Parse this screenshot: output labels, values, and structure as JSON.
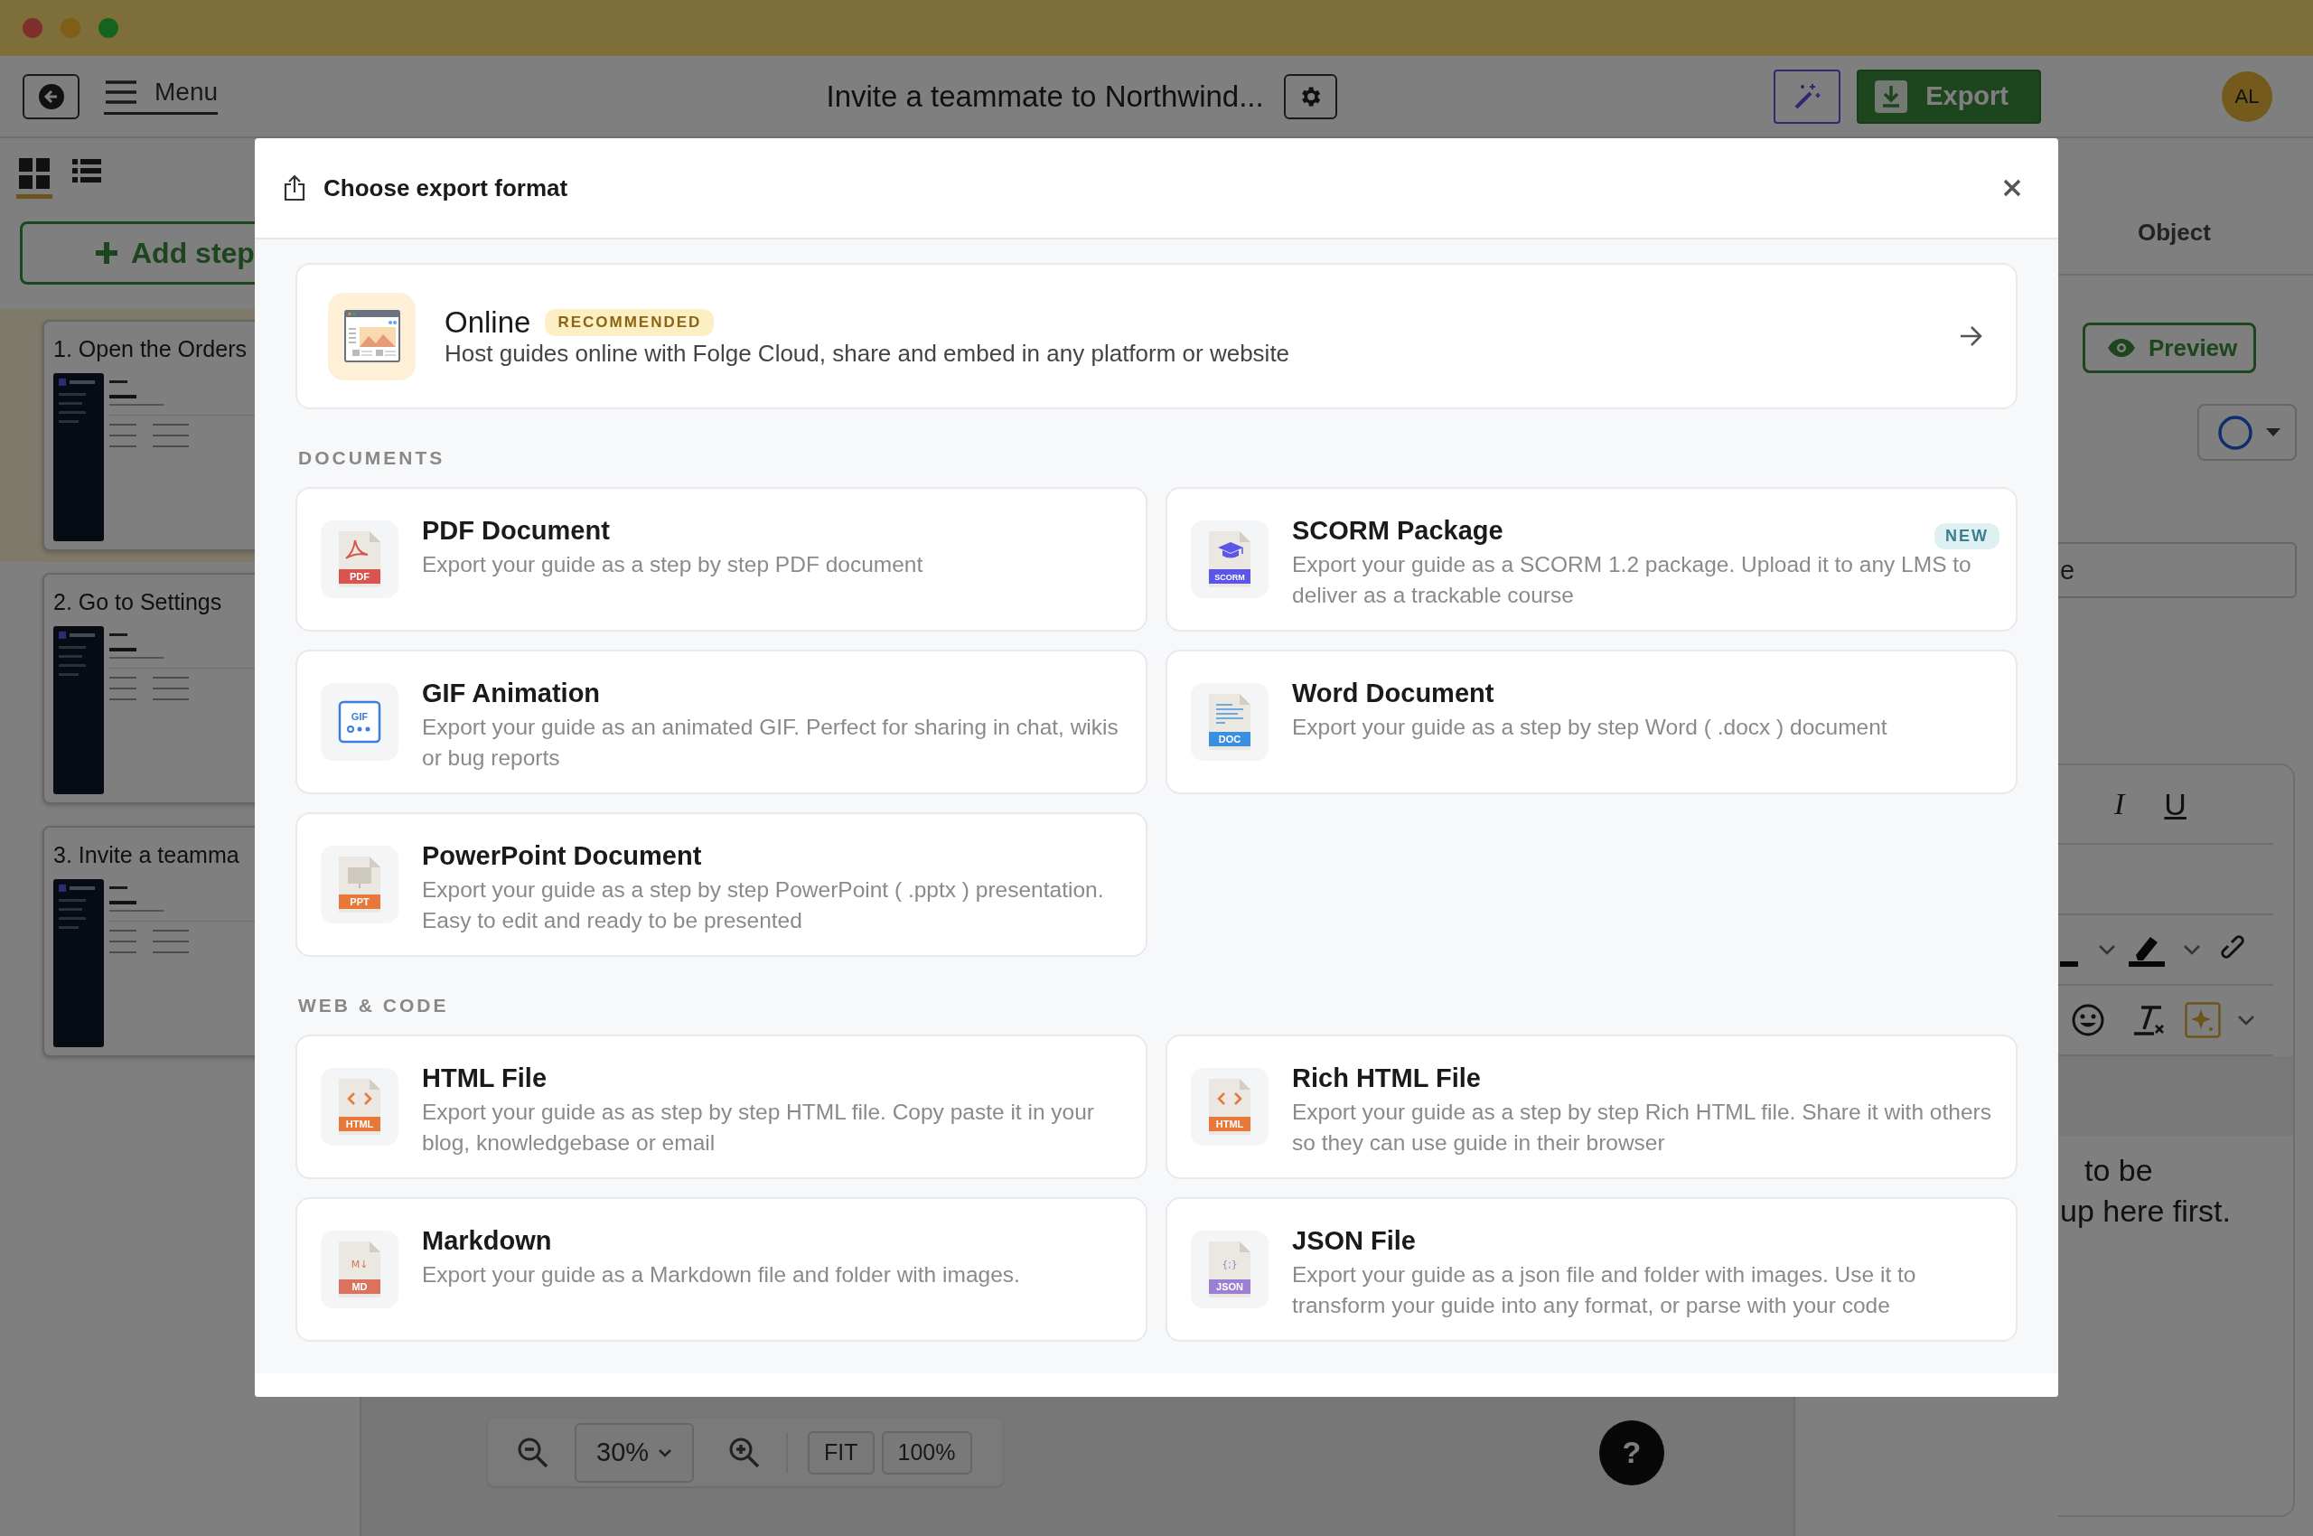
{
  "toolbar": {
    "menu_label": "Menu",
    "document_title": "Invite a teammate to Northwind...",
    "export_label": "Export",
    "avatar_initials": "AL"
  },
  "sidebar": {
    "views": [
      {
        "kind": "grid",
        "selected": true
      },
      {
        "kind": "list",
        "selected": false
      }
    ],
    "add_step_label": "Add step",
    "steps": [
      {
        "title": "1. Open the Orders",
        "selected": true
      },
      {
        "title": "2. Go to Settings",
        "selected": false
      },
      {
        "title": "3. Invite a teamma",
        "selected": false
      }
    ]
  },
  "inspector": {
    "tab_label": "Object",
    "preview_label": "Preview",
    "field_value": "e",
    "format_buttons": [
      "I",
      "U"
    ],
    "text_lines": [
      "to be",
      "up here first."
    ]
  },
  "zoom_bar": {
    "zoom_level": "30%",
    "fit_label": "FIT",
    "actual_size_label": "100%",
    "help_label": "?"
  },
  "export_dialog": {
    "title": "Choose export format",
    "featured": {
      "title": "Online",
      "badge": "RECOMMENDED",
      "description": "Host guides online with Folge Cloud, share and embed in any platform or website"
    },
    "sections": [
      {
        "heading": "DOCUMENTS",
        "formats": [
          {
            "kind": "pdf",
            "title": "PDF Document",
            "description": "Export your guide as a step by step PDF document",
            "icon_label": "PDF",
            "color": "#d9534f"
          },
          {
            "kind": "scorm",
            "title": "SCORM Package",
            "description": "Export your guide as a SCORM 1.2 package. Upload it to any LMS to deliver as a trackable course",
            "icon_label": "SCORM",
            "color": "#5b55e8",
            "badge": "NEW"
          },
          {
            "kind": "gif",
            "title": "GIF Animation",
            "description": "Export your guide as an animated GIF. Perfect for sharing in chat, wikis or bug reports",
            "icon_label": "GIF",
            "color": "#3b7de0"
          },
          {
            "kind": "doc",
            "title": "Word Document",
            "description": "Export your guide as a step by step Word ( .docx ) document",
            "icon_label": "DOC",
            "color": "#3b8fe0"
          },
          {
            "kind": "ppt",
            "title": "PowerPoint Document",
            "description": "Export your guide as a step by step PowerPoint ( .pptx ) presentation. Easy to edit and ready to be presented",
            "icon_label": "PPT",
            "color": "#e8773a"
          }
        ]
      },
      {
        "heading": "WEB & CODE",
        "formats": [
          {
            "kind": "html",
            "title": "HTML File",
            "description": "Export your guide as as step by step HTML file. Copy paste it in your blog, knowledgebase or email",
            "icon_label": "HTML",
            "color": "#e8773a"
          },
          {
            "kind": "html",
            "title": "Rich HTML File",
            "description": "Export your guide as a step by step Rich HTML file. Share it with others so they can use guide in their browser",
            "icon_label": "HTML",
            "color": "#e8773a"
          },
          {
            "kind": "markdown",
            "title": "Markdown",
            "description": "Export your guide as a Markdown file and folder with images.",
            "icon_label": "MD",
            "icon_mark": "M↓",
            "color": "#d9735f"
          },
          {
            "kind": "json",
            "title": "JSON File",
            "description": "Export your guide as a json file and folder with images. Use it to transform your guide into any format, or parse with your code",
            "icon_label": "JSON",
            "icon_mark": "{;}",
            "color": "#9b7fd0"
          }
        ]
      }
    ]
  }
}
